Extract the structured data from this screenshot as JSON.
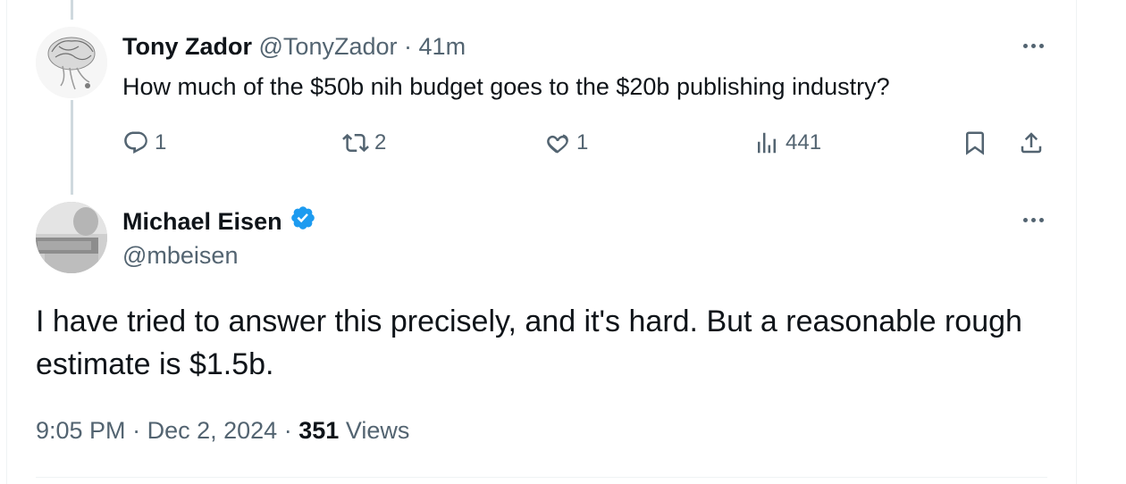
{
  "parent_tweet": {
    "author_name": "Tony Zador",
    "handle": "@TonyZador",
    "separator": "·",
    "time": "41m",
    "text": "How much of the $50b nih budget goes to the $20b publishing industry?",
    "replies": "1",
    "retweets": "2",
    "likes": "1",
    "views": "441",
    "icons": [
      "reply-icon",
      "retweet-icon",
      "like-icon",
      "views-icon",
      "bookmark-icon",
      "share-icon",
      "more-icon"
    ]
  },
  "main_tweet": {
    "author_name": "Michael Eisen",
    "handle": "@mbeisen",
    "verified": true,
    "text": "I have tried to answer this precisely, and it's hard. But a reasonable rough estimate is $1.5b.",
    "time": "9:05 PM",
    "date": "Dec 2, 2024",
    "separator": "·",
    "views_count": "351",
    "views_label": "Views"
  },
  "colors": {
    "text_primary": "#0f1419",
    "text_secondary": "#536471",
    "verified_blue": "#1d9bf0",
    "thread_line": "#cfd9de",
    "border": "#eff3f4"
  }
}
